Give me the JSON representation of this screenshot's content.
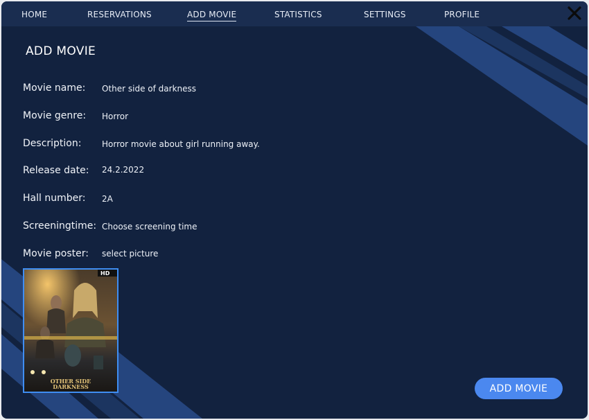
{
  "nav": {
    "items": [
      {
        "label": "HOME"
      },
      {
        "label": "RESERVATIONS"
      },
      {
        "label": "ADD MOVIE"
      },
      {
        "label": "STATISTICS"
      },
      {
        "label": "SETTINGS"
      },
      {
        "label": "PROFILE"
      }
    ],
    "active": "ADD MOVIE",
    "close_icon": "close-x-icon"
  },
  "page": {
    "title": "ADD MOVIE"
  },
  "form": {
    "fields": [
      {
        "label": "Movie name:",
        "value": "Other side of darkness"
      },
      {
        "label": "Movie genre:",
        "value": "Horror"
      },
      {
        "label": "Description:",
        "value": "Horror movie about girl running away."
      },
      {
        "label": "Release date:",
        "value": "24.2.2022"
      },
      {
        "label": "Hall number:",
        "value": "2A"
      },
      {
        "label": "Screeningtime:",
        "value": "Choose screening time"
      },
      {
        "label": "Movie poster:",
        "value": "select picture"
      }
    ]
  },
  "poster": {
    "badge": "HD",
    "title_line1": "OTHER SIDE",
    "title_line2": "DARKNESS"
  },
  "actions": {
    "add_label": "ADD MOVIE"
  },
  "colors": {
    "background": "#12223f",
    "nav": "#1a2d50",
    "stripe": "#25457e",
    "accent": "#4b88ef",
    "poster_border": "#3f8ef3"
  }
}
